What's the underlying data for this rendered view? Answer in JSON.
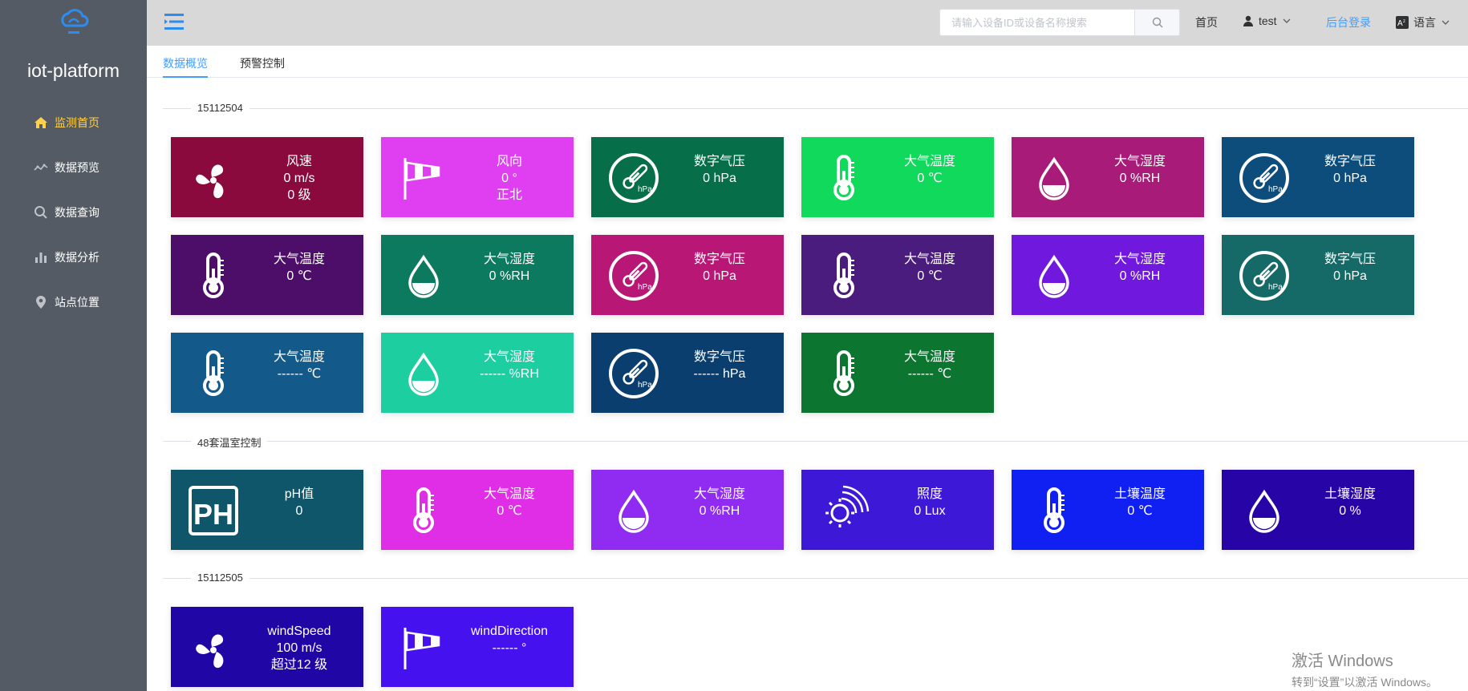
{
  "sidebar": {
    "brand": "iot-platform",
    "items": [
      {
        "label": "监测首页",
        "icon": "home-icon",
        "active": true
      },
      {
        "label": "数据预览",
        "icon": "trend-icon"
      },
      {
        "label": "数据查询",
        "icon": "search-icon"
      },
      {
        "label": "数据分析",
        "icon": "bar-chart-icon"
      },
      {
        "label": "站点位置",
        "icon": "location-pin-icon"
      }
    ]
  },
  "header": {
    "search_placeholder": "请输入设备ID或设备名称搜索",
    "home": "首页",
    "user": "test",
    "admin_login": "后台登录",
    "language": "语言"
  },
  "tabs": [
    {
      "label": "数据概览",
      "active": true
    },
    {
      "label": "预警控制"
    }
  ],
  "groups": [
    {
      "title": "15112504"
    },
    {
      "title": "48套温室控制"
    },
    {
      "title": "15112505"
    }
  ],
  "cards": [
    {
      "icon": "fan-icon",
      "color": "#8a0a3e",
      "l1": "风速",
      "l2": "0 m/s",
      "l3": "0 级"
    },
    {
      "icon": "windsock-icon",
      "color": "#df3ff0",
      "l1": "风向",
      "l2": "0 °",
      "l3": "正北"
    },
    {
      "icon": "barometer-icon",
      "color": "#066e49",
      "l1": "数字气压",
      "l2": "0 hPa"
    },
    {
      "icon": "thermometer-icon",
      "color": "#10d95c",
      "l1": "大气温度",
      "l2": "0 ℃"
    },
    {
      "icon": "droplet-icon",
      "color": "#a91b79",
      "l1": "大气湿度",
      "l2": "0 %RH"
    },
    {
      "icon": "barometer-icon",
      "color": "#0c4d7c",
      "l1": "数字气压",
      "l2": "0 hPa"
    },
    {
      "icon": "thermometer-icon",
      "color": "#4d0e6a",
      "l1": "大气温度",
      "l2": "0 ℃"
    },
    {
      "icon": "droplet-icon",
      "color": "#0b7a5f",
      "l1": "大气湿度",
      "l2": "0 %RH"
    },
    {
      "icon": "barometer-icon",
      "color": "#b91776",
      "l1": "数字气压",
      "l2": "0 hPa"
    },
    {
      "icon": "thermometer-icon",
      "color": "#4a1c7d",
      "l1": "大气温度",
      "l2": "0 ℃"
    },
    {
      "icon": "droplet-icon",
      "color": "#7118df",
      "l1": "大气湿度",
      "l2": "0 %RH"
    },
    {
      "icon": "barometer-icon",
      "color": "#156a67",
      "l1": "数字气压",
      "l2": "0 hPa"
    },
    {
      "icon": "thermometer-icon",
      "color": "#135a8b",
      "l1": "大气温度",
      "l2": "------ ℃"
    },
    {
      "icon": "droplet-icon",
      "color": "#1dcfa0",
      "l1": "大气湿度",
      "l2": "------ %RH"
    },
    {
      "icon": "barometer-icon",
      "color": "#093e6f",
      "l1": "数字气压",
      "l2": "------ hPa"
    },
    {
      "icon": "thermometer-icon",
      "color": "#0c7530",
      "l1": "大气温度",
      "l2": "------ ℃"
    },
    {
      "icon": "ph-icon",
      "color": "#10566a",
      "l1": "pH值",
      "l2": "0"
    },
    {
      "icon": "thermometer-icon",
      "color": "#e02ee6",
      "l1": "大气温度",
      "l2": "0 ℃"
    },
    {
      "icon": "droplet-icon",
      "color": "#902cf1",
      "l1": "大气湿度",
      "l2": "0 %RH"
    },
    {
      "icon": "sun-icon",
      "color": "#3d18d6",
      "l1": "照度",
      "l2": "0 Lux"
    },
    {
      "icon": "thermometer-icon",
      "color": "#101ff2",
      "l1": "土壤温度",
      "l2": "0 ℃"
    },
    {
      "icon": "droplet-icon",
      "color": "#2704a5",
      "l1": "土壤湿度",
      "l2": "0 %"
    },
    {
      "icon": "fan-icon",
      "color": "#2106a6",
      "l1": "windSpeed",
      "l2": "100 m/s",
      "l3": "超过12 级"
    },
    {
      "icon": "windsock-icon",
      "color": "#4511ee",
      "l1": "windDirection",
      "l2": "------ °"
    }
  ],
  "watermark": {
    "line1": "激活 Windows",
    "line2": "转到“设置”以激活 Windows。"
  }
}
